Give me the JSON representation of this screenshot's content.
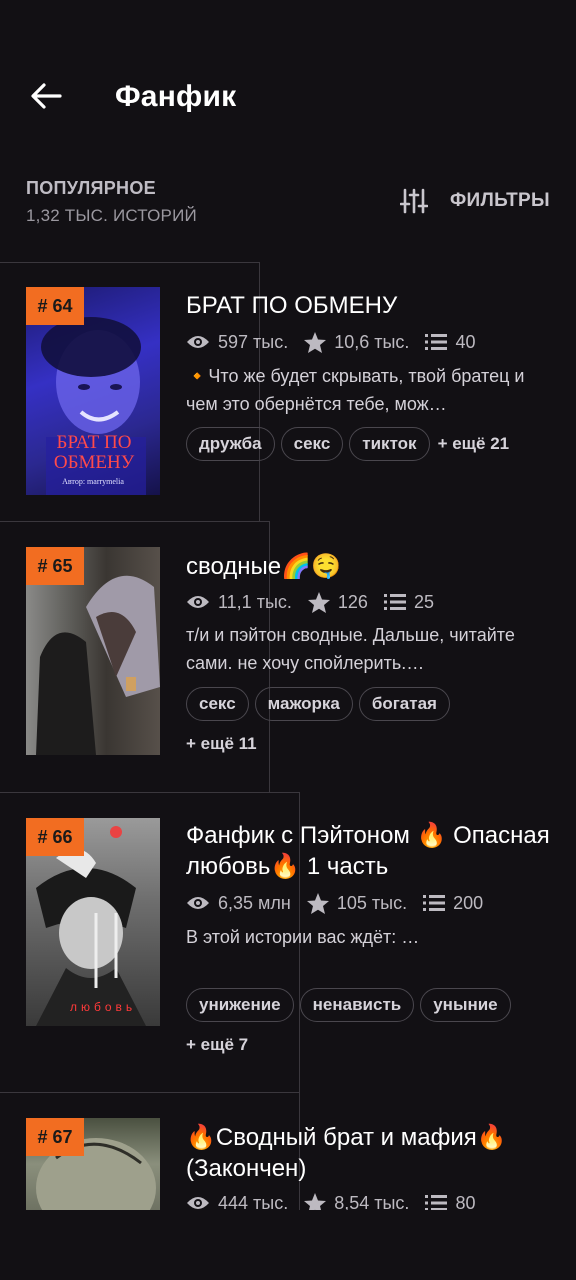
{
  "header": {
    "title": "Фанфик"
  },
  "section": {
    "title": "ПОПУЛЯРНОЕ",
    "count": "1,32 ТЫС. ИСТОРИЙ",
    "filters_label": "ФИЛЬТРЫ"
  },
  "stories": [
    {
      "rank": "# 64",
      "title": "БРАТ ПО ОБМЕНУ",
      "views": "597 тыс.",
      "votes": "10,6 тыс.",
      "parts": "40",
      "description": "🔸Что же будет скрывать, твой братец и чем это обернётся тебе, мож…",
      "tags": [
        "дружба",
        "секс",
        "тикток"
      ],
      "more_tags": "+ ещё 21",
      "cover_text": "БРАТ ПО ОБМЕНУ",
      "cover_author": "Автор: marrymelia"
    },
    {
      "rank": "# 65",
      "title": "сводные🌈🤤",
      "views": "11,1 тыс.",
      "votes": "126",
      "parts": "25",
      "description": "т/и и пэйтон сводные. Дальше, читайте сами. не хочу спойлерить.…",
      "tags": [
        "секс",
        "мажорка",
        "богатая"
      ],
      "more_tags": "+ ещё 11"
    },
    {
      "rank": "# 66",
      "title": "Фанфик с Пэйтоном 🔥 Опасная любовь🔥 1 часть",
      "views": "6,35 млн",
      "votes": "105 тыс.",
      "parts": "200",
      "description": "В этой истории вас ждёт: …",
      "tags": [
        "унижение",
        "ненависть",
        "уныние"
      ],
      "more_tags": "+ ещё 7",
      "cover_text": "любовь"
    },
    {
      "rank": "# 67",
      "title": "🔥Сводный брат и мафия🔥 (Закончен)",
      "views": "444 тыс.",
      "votes": "8,54 тыс.",
      "parts": "80"
    }
  ],
  "colors": {
    "accent": "#f26d21",
    "background": "#121014"
  }
}
